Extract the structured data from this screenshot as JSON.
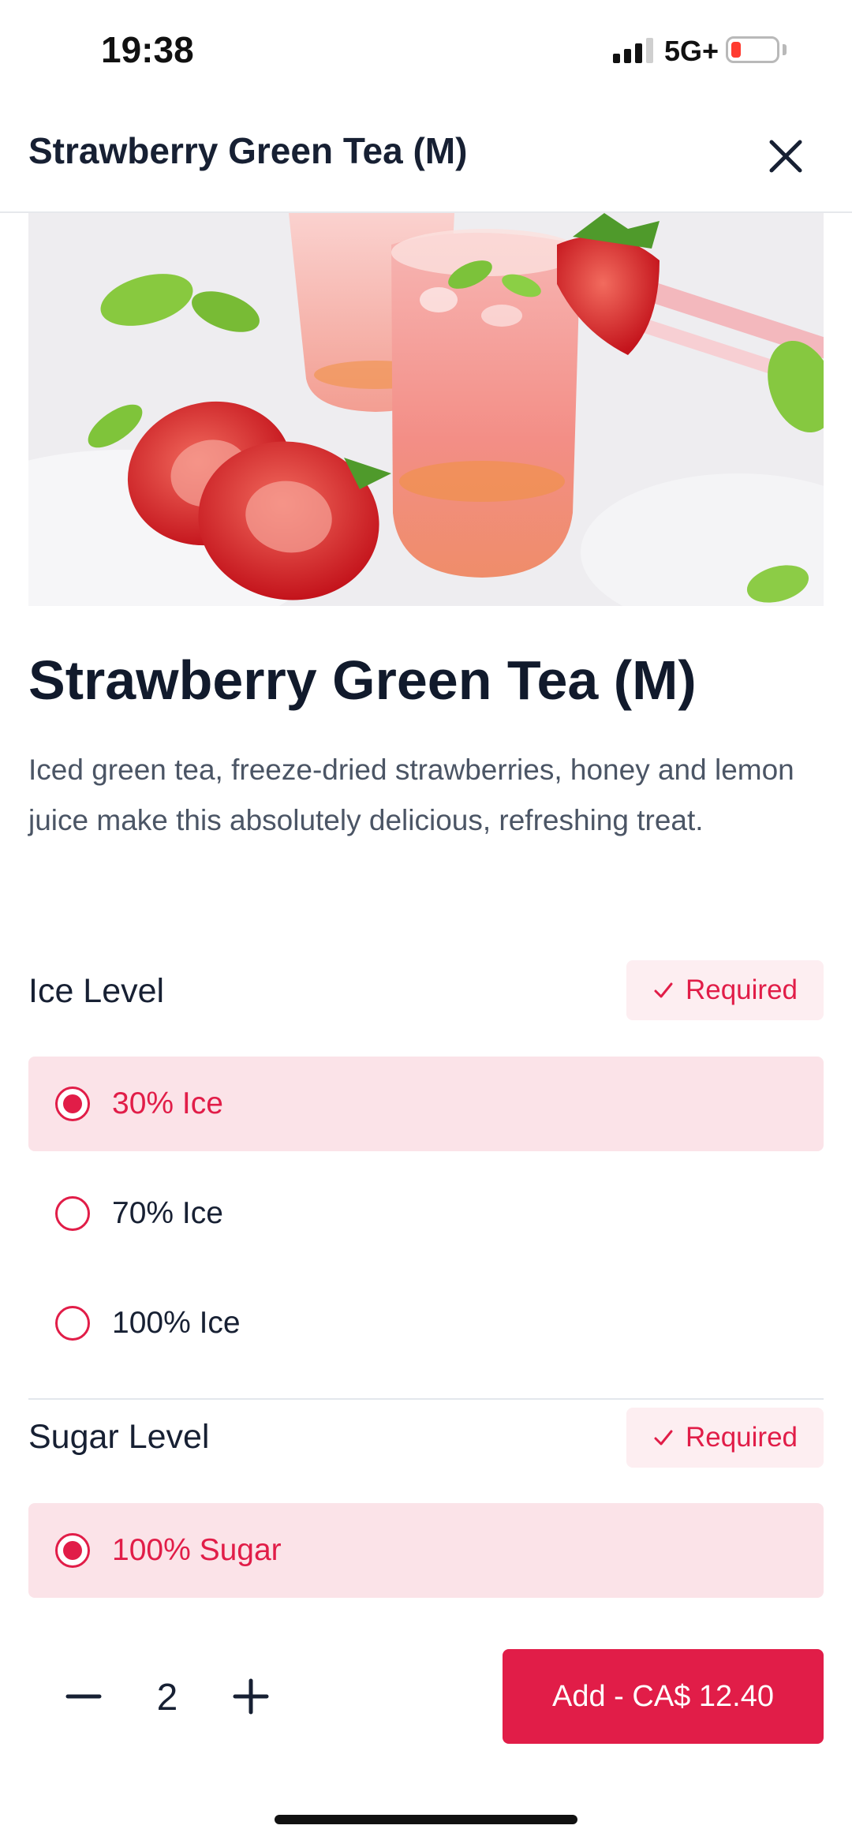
{
  "status_bar": {
    "time": "19:38",
    "network": "5G+",
    "battery_color": "#ff3b30"
  },
  "header": {
    "title": "Strawberry Green Tea (M)",
    "close_icon": "close-icon"
  },
  "product": {
    "image_icon": "strawberry-drink-photo",
    "title": "Strawberry Green Tea (M)",
    "description": " Iced green tea, freeze-dried strawberries, honey and lemon juice make this absolutely delicious, refreshing treat."
  },
  "ice_section": {
    "title": "Ice Level",
    "badge": "Required",
    "options": [
      {
        "label": "30% Ice",
        "selected": true
      },
      {
        "label": "70% Ice",
        "selected": false
      },
      {
        "label": "100% Ice",
        "selected": false
      }
    ]
  },
  "sugar_section": {
    "title": "Sugar Level",
    "badge": "Required",
    "options": [
      {
        "label": "100% Sugar",
        "selected": true
      }
    ]
  },
  "footer": {
    "quantity": "2",
    "add_label": "Add - CA$ 12.40"
  },
  "colors": {
    "accent": "#e11d48",
    "selected_bg": "#fbe3e8",
    "badge_bg": "#fdeef1",
    "text": "#172033"
  }
}
